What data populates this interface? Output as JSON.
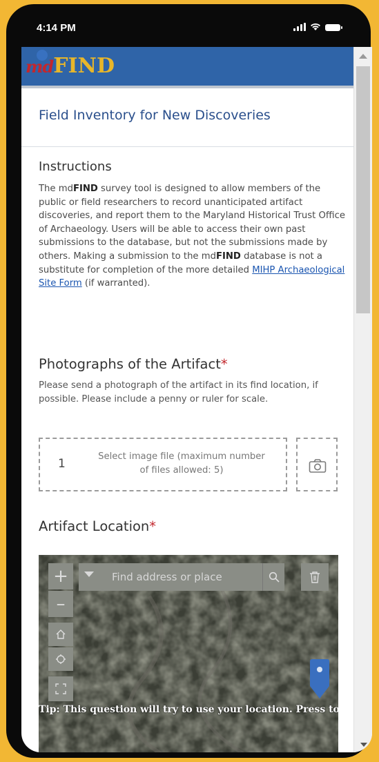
{
  "status_bar": {
    "time": "4:14 PM"
  },
  "banner": {
    "logo_prefix": "md",
    "logo_suffix": "FIND"
  },
  "form": {
    "title": "Field Inventory for New Discoveries"
  },
  "instructions": {
    "heading": "Instructions",
    "text_1": "The md",
    "text_bold_1": "FIND",
    "text_2": " survey tool is designed to allow members of the public or field researchers to record unanticipated artifact discoveries, and report them to the Maryland Historical Trust Office of Archaeology. Users will be able to access their own past submissions to the database, but not the submissions made by others. Making a submission to the md",
    "text_bold_2": "FIND",
    "text_3": " database is not a substitute for completion of the more detailed ",
    "link": "MIHP Archaeological Site Form",
    "text_4": " (if warranted)."
  },
  "photos": {
    "heading": "Photographs of the Artifact",
    "required_mark": "*",
    "description": "Please send a photograph of the artifact in its find location, if possible. Please include a penny or ruler for scale.",
    "count": "1",
    "upload_text": "Select image file (maximum number of files allowed: 5)"
  },
  "location": {
    "heading": "Artifact Location",
    "required_mark": "*",
    "search_placeholder": "Find address or place",
    "tip": "Tip: This question will try to use your location. Press to"
  },
  "colors": {
    "background": "#f2b734",
    "banner": "#2f64a8",
    "title": "#2a4f8c",
    "required": "#c2272d",
    "link": "#1a55b0"
  }
}
